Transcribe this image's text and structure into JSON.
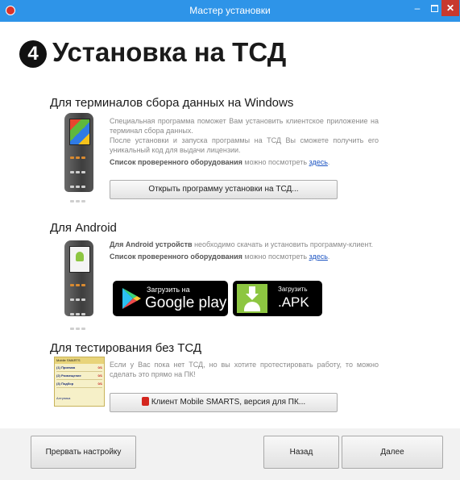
{
  "window": {
    "title": "Мастер установки",
    "minimize_glyph": "–",
    "close_glyph": "✕",
    "accent_color": "#2e94e8"
  },
  "header": {
    "step_number": "4",
    "title": "Установка на ТСД"
  },
  "windows_section": {
    "title": "Для терминалов сбора данных на Windows",
    "description_1": "Специальная программа поможет Вам установить клиентское приложение на терминал сбора данных.",
    "description_2": "После установки и запуска программы на ТСД Вы сможете получить его уникальный код для выдачи лицензии.",
    "equipment_label": "Список проверенного оборудования",
    "equipment_text": "можно посмотреть",
    "equipment_link": "здесь",
    "install_button": "Открыть программу установки на ТСД..."
  },
  "android_section": {
    "title": "Для Android",
    "description_bold": "Для Android устройств",
    "description": "необходимо скачать и установить программу-клиент.",
    "equipment_label": "Список проверенного оборудования",
    "equipment_text": "можно посмотреть",
    "equipment_link": "здесь",
    "google_play_small": "Загрузить на",
    "google_play_big": "Google play",
    "apk_small": "Загрузить",
    "apk_big": ".APK"
  },
  "test_section": {
    "title": "Для тестирования без ТСД",
    "description": "Если у Вас пока нет ТСД, но вы хотите протестировать работу, то можно сделать это прямо на ПК!",
    "client_button": "Клиент Mobile SMARTS, версия для ПК...",
    "preview": {
      "title": "Mobile SMARTS",
      "rows": [
        {
          "num": "(1)",
          "label": "Приемка",
          "count": "0/1"
        },
        {
          "num": "(2)",
          "label": "Размещение",
          "count": "0/1"
        },
        {
          "num": "(3)",
          "label": "Подбор",
          "count": "0/1"
        }
      ],
      "footer": "Алтуника"
    }
  },
  "footer": {
    "abort_button": "Прервать настройку",
    "back_button": "Назад",
    "next_button": "Далее"
  }
}
